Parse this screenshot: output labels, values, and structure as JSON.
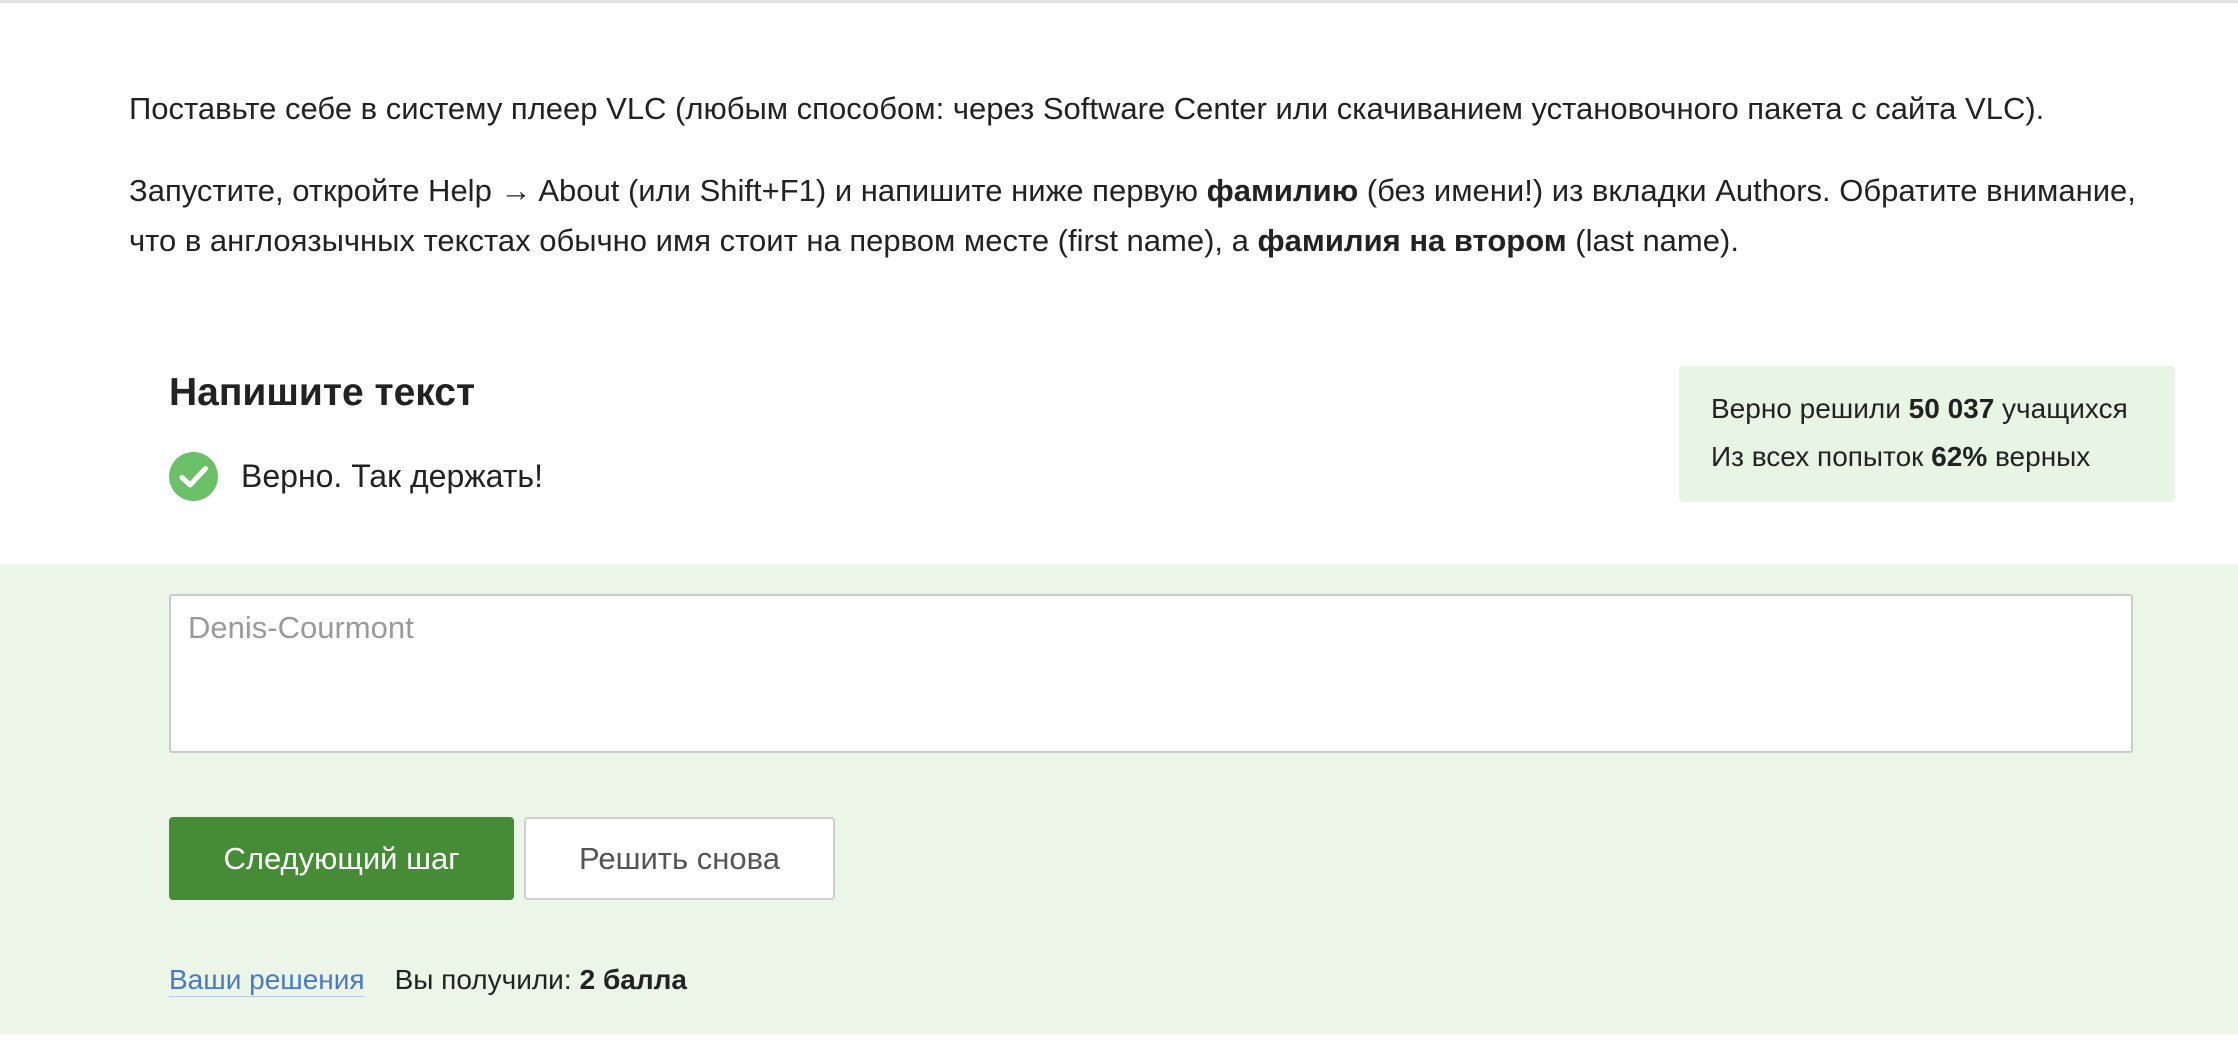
{
  "lesson": {
    "p1": "Поставьте себе в систему плеер VLC (любым способом: через Software Center или скачиванием установочного пакета с сайта VLC).",
    "p2_a": "Запустите, откройте Help → About (или Shift+F1) и напишите ниже первую ",
    "p2_bold1": "фамилию",
    "p2_b": " (без имени!) из вкладки Authors. Обратите внимание, что в англоязычных текстах обычно имя стоит на первом месте (first name), а ",
    "p2_bold2": "фамилия на втором",
    "p2_c": " (last name)."
  },
  "quiz": {
    "title": "Напишите текст",
    "feedback": "Верно. Так держать!",
    "feedback_icon": "check-circle-icon"
  },
  "stats": {
    "line1_prefix": "Верно решили ",
    "line1_value": "50 037",
    "line1_suffix": " учащихся",
    "line2_prefix": "Из всех попыток ",
    "line2_value": "62%",
    "line2_suffix": " верных"
  },
  "answer": {
    "value": "Denis-Courmont"
  },
  "buttons": {
    "next": "Следующий шаг",
    "retry": "Решить снова"
  },
  "footer": {
    "solutions_link": "Ваши решения",
    "score_label": "Вы получили:",
    "score_value": "2 балла"
  },
  "colors": {
    "success": "#6cc067",
    "primary_button": "#468c36",
    "answer_zone_bg": "#ebf6e9",
    "stats_bg": "#e8f5e5",
    "link": "#4a79c9"
  }
}
